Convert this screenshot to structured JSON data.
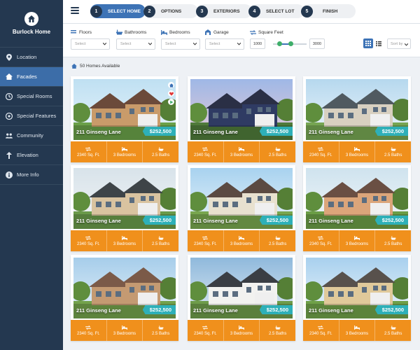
{
  "brand": {
    "name": "Burlock Home"
  },
  "sidebar": {
    "items": [
      {
        "label": "Location",
        "icon": "map-pin-icon",
        "active": false
      },
      {
        "label": "Facades",
        "icon": "home-icon",
        "active": true
      },
      {
        "label": "Special Rooms",
        "icon": "special-rooms-icon",
        "active": false
      },
      {
        "label": "Special Features",
        "icon": "special-features-icon",
        "active": false
      },
      {
        "label": "Community",
        "icon": "community-icon",
        "active": false
      },
      {
        "label": "Elevation",
        "icon": "elevation-icon",
        "active": false
      },
      {
        "label": "More Info",
        "icon": "info-icon",
        "active": false
      }
    ]
  },
  "steps": [
    {
      "num": "1",
      "label": "SELECT HOME",
      "active": true
    },
    {
      "num": "2",
      "label": "OPTIONS",
      "active": false
    },
    {
      "num": "3",
      "label": "EXTERIORS",
      "active": false
    },
    {
      "num": "4",
      "label": "SELECT LOT",
      "active": false
    },
    {
      "num": "5",
      "label": "FINISH",
      "active": false
    }
  ],
  "filters": {
    "floors": {
      "label": "Floors",
      "value": "Select"
    },
    "bathrooms": {
      "label": "Bathrooms",
      "value": "Select"
    },
    "bedrooms": {
      "label": "Bedrooms",
      "value": "Select"
    },
    "garage": {
      "label": "Garage",
      "value": "Select"
    },
    "square_feet": {
      "label": "Square Feet",
      "min": "1000",
      "max": "3000"
    },
    "sort": {
      "value": "Sort by"
    }
  },
  "results": {
    "count_text": "50 Homes Available"
  },
  "colors": {
    "sidebar": "#243850",
    "accent": "#3d73b6",
    "price": "#2eb0b8",
    "stats": "#f0901c"
  },
  "homes": [
    {
      "address": "211 Ginseng Lane",
      "price": "$252,500",
      "sqft": "2340 Sq. Ft.",
      "bedrooms": "3 Bedrooms",
      "baths": "2.5 Baths"
    },
    {
      "address": "211 Ginseng Lane",
      "price": "$252,500",
      "sqft": "2340 Sq. Ft.",
      "bedrooms": "3 Bedrooms",
      "baths": "2.5 Baths"
    },
    {
      "address": "211 Ginseng Lane",
      "price": "$252,500",
      "sqft": "2340 Sq. Ft.",
      "bedrooms": "3 Bedrooms",
      "baths": "2.5 Baths"
    },
    {
      "address": "211 Ginseng Lane",
      "price": "$252,500",
      "sqft": "2340 Sq. Ft.",
      "bedrooms": "3 Bedrooms",
      "baths": "2.5 Baths"
    },
    {
      "address": "211 Ginseng Lane",
      "price": "$252,500",
      "sqft": "2340 Sq. Ft.",
      "bedrooms": "3 Bedrooms",
      "baths": "2.5 Baths"
    },
    {
      "address": "211 Ginseng Lane",
      "price": "$252,500",
      "sqft": "2340 Sq. Ft.",
      "bedrooms": "3 Bedrooms",
      "baths": "2.5 Baths"
    },
    {
      "address": "211 Ginseng Lane",
      "price": "$252,500",
      "sqft": "2340 Sq. Ft.",
      "bedrooms": "3 Bedrooms",
      "baths": "2.5 Baths"
    },
    {
      "address": "211 Ginseng Lane",
      "price": "$252,500",
      "sqft": "2340 Sq. Ft.",
      "bedrooms": "3 Bedrooms",
      "baths": "2.5 Baths"
    },
    {
      "address": "211 Ginseng Lane",
      "price": "$252,500",
      "sqft": "2340 Sq. Ft.",
      "bedrooms": "3 Bedrooms",
      "baths": "2.5 Baths"
    }
  ]
}
